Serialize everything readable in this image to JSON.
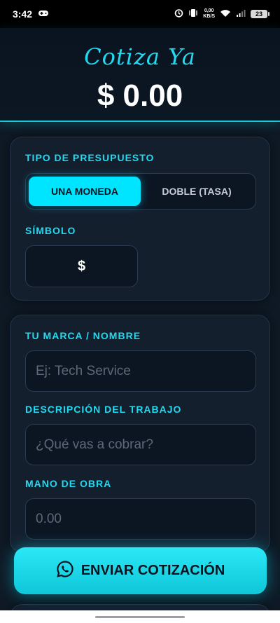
{
  "status": {
    "time": "3:42",
    "net_speed_top": "0,00",
    "net_speed_bottom": "KB/S",
    "battery": "23"
  },
  "header": {
    "brand": "Cotiza Ya",
    "total": "$ 0.00"
  },
  "budget": {
    "label": "TIPO DE PRESUPUESTO",
    "options": [
      "UNA MONEDA",
      "DOBLE (TASA)"
    ],
    "selected": "UNA MONEDA",
    "symbol_label": "SÍMBOLO",
    "symbol_value": "$"
  },
  "form": {
    "brand_label": "TU MARCA / NOMBRE",
    "brand_placeholder": "Ej: Tech Service",
    "desc_label": "DESCRIPCIÓN DEL TRABAJO",
    "desc_placeholder": "¿Qué vas a cobrar?",
    "labor_label": "MANO DE OBRA",
    "labor_placeholder": "0.00"
  },
  "actions": {
    "send_label": "ENVIAR COTIZACIÓN"
  },
  "colors": {
    "accent": "#00e5ff",
    "background": "#0f1a26",
    "card": "#141f2e"
  }
}
